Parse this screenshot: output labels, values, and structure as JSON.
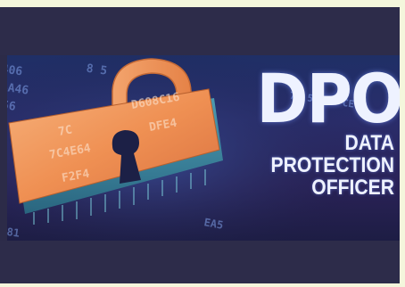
{
  "banner": {
    "title": "DPO",
    "subtitle_lines": [
      "DATA",
      "PROTECTION",
      "OFFICER"
    ]
  },
  "colors": {
    "frame": "#2c2b48",
    "page_background": "#f4f6dc",
    "lock_body": "#f0965a",
    "lock_shackle": "#ef9b62",
    "text": "#eef2ff"
  },
  "icons": {
    "padlock": "padlock-icon"
  }
}
